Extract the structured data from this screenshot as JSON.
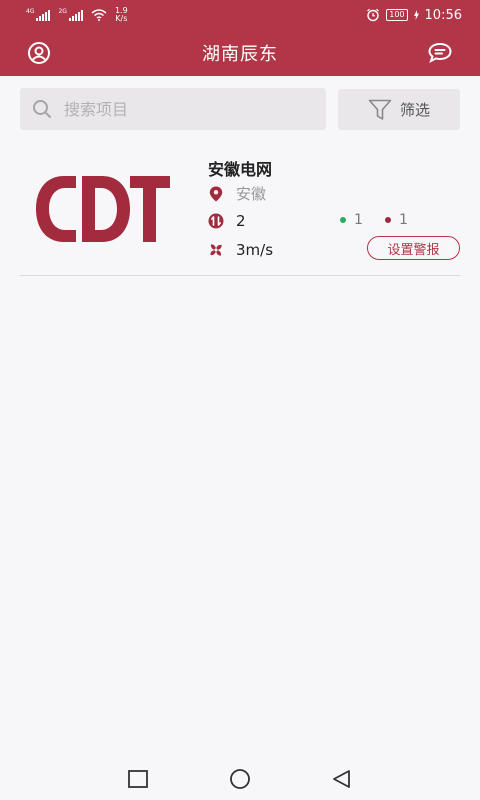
{
  "status_bar": {
    "signal1_tag": "4G",
    "signal2_tag": "2G",
    "net_speed_value": "1.9",
    "net_speed_unit": "K/s",
    "battery": "100",
    "time": "10:56"
  },
  "app_bar": {
    "title": "湖南辰东",
    "left_icon": "user-icon",
    "right_icon": "message-icon"
  },
  "search": {
    "placeholder": "搜索项目",
    "value": ""
  },
  "filter": {
    "label": "筛选"
  },
  "colors": {
    "brand": "#b23647",
    "online": "#2eaa5e",
    "offline": "#9a2a3c"
  },
  "projects": [
    {
      "logo_text": "CDT",
      "name": "安徽电网",
      "location": "安徽",
      "device_count": "2",
      "online_count": "1",
      "offline_count": "1",
      "wind_speed": "3m/s",
      "alarm_button": "设置警报"
    }
  ]
}
